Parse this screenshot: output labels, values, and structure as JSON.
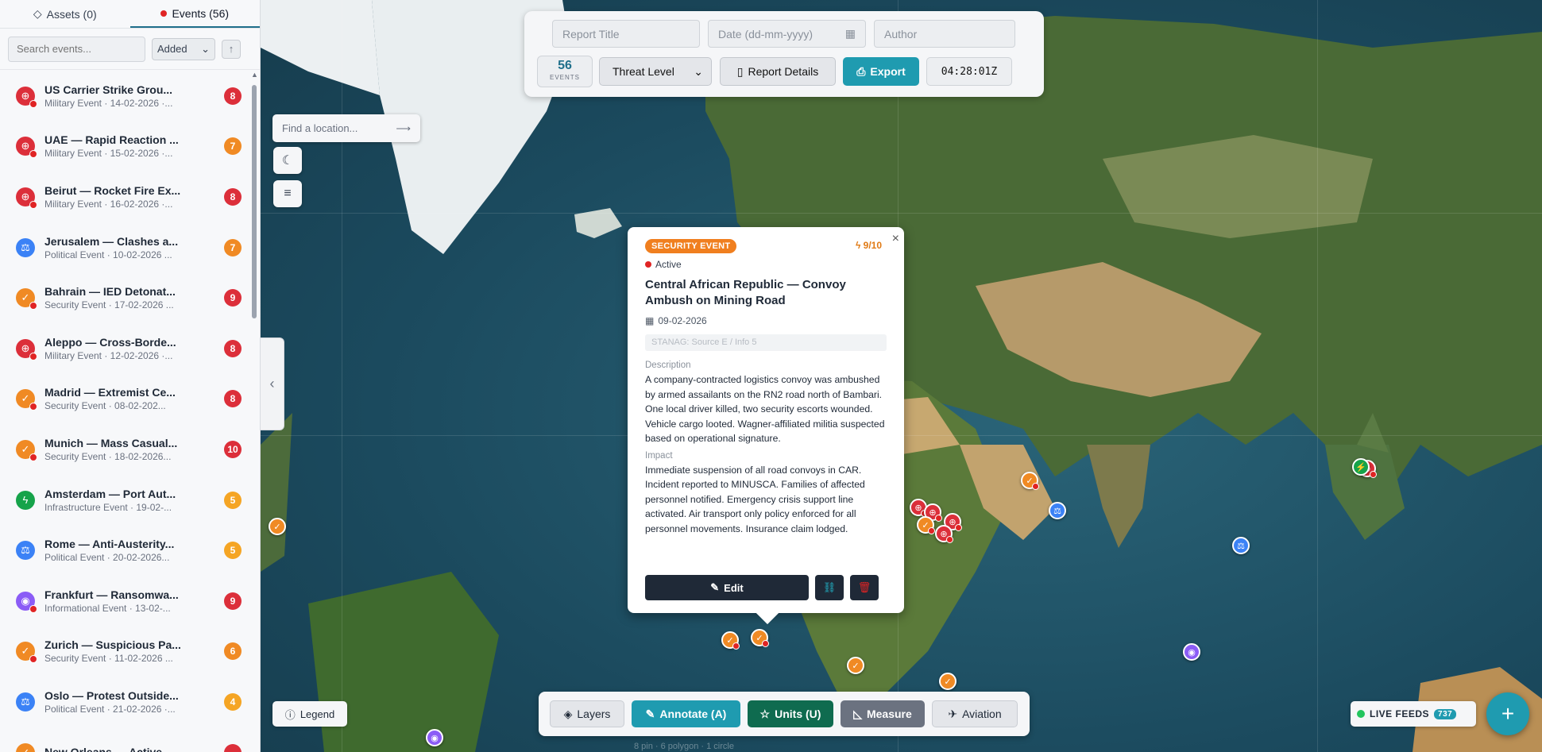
{
  "sidebar": {
    "tabs": [
      {
        "label": "Assets (0)",
        "icon": "diamond-icon"
      },
      {
        "label": "Events (56)",
        "icon": "red-dot-icon"
      }
    ],
    "search_placeholder": "Search events...",
    "sort_value": "Added",
    "sort_direction_icon": "arrow-up-icon",
    "events": [
      {
        "title": "US Carrier Strike Grou...",
        "sub": "Military Event · 14-02-2026 ·...",
        "score": "8",
        "type": "military",
        "score_color": "#dc2f3a"
      },
      {
        "title": "UAE — Rapid Reaction ...",
        "sub": "Military Event · 15-02-2026 ·...",
        "score": "7",
        "type": "military",
        "score_color": "#f08a24"
      },
      {
        "title": "Beirut — Rocket Fire Ex...",
        "sub": "Military Event · 16-02-2026 ·...",
        "score": "8",
        "type": "military",
        "score_color": "#dc2f3a"
      },
      {
        "title": "Jerusalem — Clashes a...",
        "sub": "Political Event · 10-02-2026 ...",
        "score": "7",
        "type": "political",
        "score_color": "#f08a24"
      },
      {
        "title": "Bahrain — IED Detonat...",
        "sub": "Security Event · 17-02-2026 ...",
        "score": "9",
        "type": "security",
        "score_color": "#dc2f3a"
      },
      {
        "title": "Aleppo — Cross-Borde...",
        "sub": "Military Event · 12-02-2026 ·...",
        "score": "8",
        "type": "military",
        "score_color": "#dc2f3a"
      },
      {
        "title": "Madrid — Extremist Ce...",
        "sub": "Security Event · 08-02-202...",
        "score": "8",
        "type": "security",
        "score_color": "#dc2f3a"
      },
      {
        "title": "Munich — Mass Casual...",
        "sub": "Security Event · 18-02-2026...",
        "score": "10",
        "type": "security",
        "score_color": "#dc2f3a"
      },
      {
        "title": "Amsterdam — Port Aut...",
        "sub": "Infrastructure Event · 19-02-...",
        "score": "5",
        "type": "infrastructure",
        "score_color": "#f5a524"
      },
      {
        "title": "Rome — Anti-Austerity...",
        "sub": "Political Event · 20-02-2026...",
        "score": "5",
        "type": "political",
        "score_color": "#f5a524"
      },
      {
        "title": "Frankfurt — Ransomwa...",
        "sub": "Informational Event · 13-02-...",
        "score": "9",
        "type": "informational",
        "score_color": "#dc2f3a"
      },
      {
        "title": "Zurich — Suspicious Pa...",
        "sub": "Security Event · 11-02-2026 ...",
        "score": "6",
        "type": "security",
        "score_color": "#f08a24"
      },
      {
        "title": "Oslo — Protest Outside...",
        "sub": "Political Event · 21-02-2026 ·...",
        "score": "4",
        "type": "political",
        "score_color": "#f5a524"
      },
      {
        "title": "New Orleans — Active ...",
        "sub": "",
        "score": "",
        "type": "security",
        "score_color": "#dc2f3a"
      }
    ]
  },
  "report_bar": {
    "title_placeholder": "Report Title",
    "date_placeholder": "Date (dd-mm-yyyy)",
    "author_placeholder": "Author",
    "events_count": "56",
    "events_label": "EVENTS",
    "threat_level_label": "Threat Level",
    "report_details_label": "Report Details",
    "export_label": "Export",
    "clock": "04:28:01Z"
  },
  "map_controls": {
    "location_placeholder": "Find a location...",
    "theme_icon": "moon-icon",
    "menu_icon": "hamburger-icon"
  },
  "popup": {
    "tag": "SECURITY EVENT",
    "score": "9/10",
    "status": "Active",
    "title": "Central African Republic — Convoy Ambush on Mining Road",
    "date": "09-02-2026",
    "stanag": "STANAG: Source E / Info 5",
    "description_heading": "Description",
    "description": "A company-contracted logistics convoy was ambushed by armed assailants on the RN2 road north of Bambari. One local driver killed, two security escorts wounded. Vehicle cargo looted. Wagner-affiliated militia suspected based on operational signature.",
    "impact_heading": "Impact",
    "impact": "Immediate suspension of all road convoys in CAR. Incident reported to MINUSCA. Families of affected personnel notified. Emergency crisis support line activated. Air transport only policy enforced for all personnel movements. Insurance claim lodged.",
    "edit_label": "Edit"
  },
  "toolbar": {
    "layers": "Layers",
    "annotate": "Annotate (A)",
    "units": "Units (U)",
    "measure": "Measure",
    "aviation": "Aviation"
  },
  "legend_label": "Legend",
  "live_feeds": {
    "label": "LIVE FEEDS",
    "count": "737"
  },
  "status_strip": "8 pin · 6 polygon · 1 circle",
  "colors": {
    "accent": "#1f9bb0",
    "military": "#dc2f3a",
    "security": "#f08a24",
    "political": "#3b82f6",
    "informational": "#8b5cf6",
    "infrastructure": "#16a34a"
  }
}
